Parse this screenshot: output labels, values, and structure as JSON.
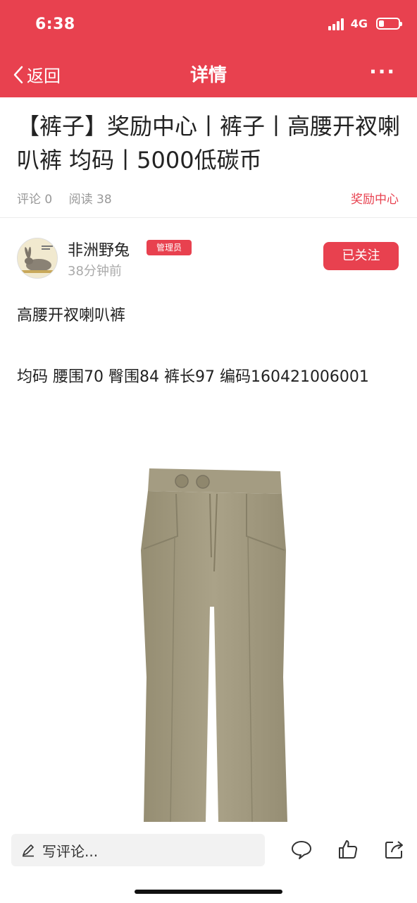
{
  "status_bar": {
    "time": "6:38",
    "network": "4G"
  },
  "nav": {
    "back_label": "返回",
    "title": "详情",
    "more_icon": "more-dots-icon"
  },
  "article": {
    "title": "【裤子】奖励中心丨裤子丨高腰开衩喇叭裤 均码丨5000低碳币",
    "comments": "评论 0",
    "reads": "阅读 38",
    "category": "奖励中心"
  },
  "author": {
    "name": "非洲野兔",
    "badge": "管理员",
    "time": "38分钟前",
    "follow_label": "已关注"
  },
  "content": {
    "line1": "高腰开衩喇叭裤",
    "line2": "均码  腰围70  臀围84  裤长97    编码160421006001"
  },
  "bottom_bar": {
    "comment_placeholder": "写评论...",
    "icons": [
      "comment-icon",
      "thumbs-up-icon",
      "share-icon"
    ]
  },
  "colors": {
    "accent": "#e8414f",
    "product": "#a39b80"
  }
}
